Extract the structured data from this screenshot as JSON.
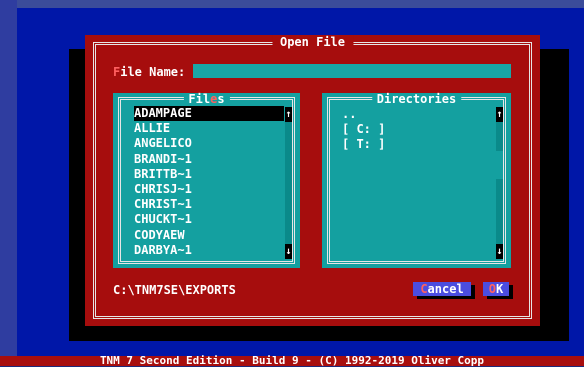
{
  "dialog": {
    "title": "Open File",
    "filename_label_hotkey": "F",
    "filename_label_rest": "ile Name:",
    "filename_value": ""
  },
  "files": {
    "title_pre": "Fil",
    "title_hot": "e",
    "title_post": "s",
    "items": [
      "ADAMPAGE",
      "ALLIE",
      "ANGELICO",
      "BRANDI~1",
      "BRITTB~1",
      "CHRISJ~1",
      "CHRIST~1",
      "CHUCKT~1",
      "CODYAEW",
      "DARBYA~1"
    ],
    "selected_index": 0
  },
  "directories": {
    "title": "Directories",
    "items": [
      "..",
      "[ C: ]",
      "[ T: ]"
    ]
  },
  "current_path": "C:\\TNM7SE\\EXPORTS",
  "buttons": {
    "cancel_hot": "C",
    "cancel_rest": "ancel",
    "ok_hot": "O",
    "ok_rest": "K"
  },
  "status_bar": "TNM 7 Second Edition - Build 9 - (C) 1992-2019 Oliver Copp",
  "icons": {
    "scroll_up": "up-arrow-icon",
    "scroll_down": "down-arrow-icon"
  },
  "colors": {
    "dialog": "#a60d0d",
    "panel": "#14a0a0",
    "desktop": "#0017a8",
    "button": "#4b4de0"
  }
}
